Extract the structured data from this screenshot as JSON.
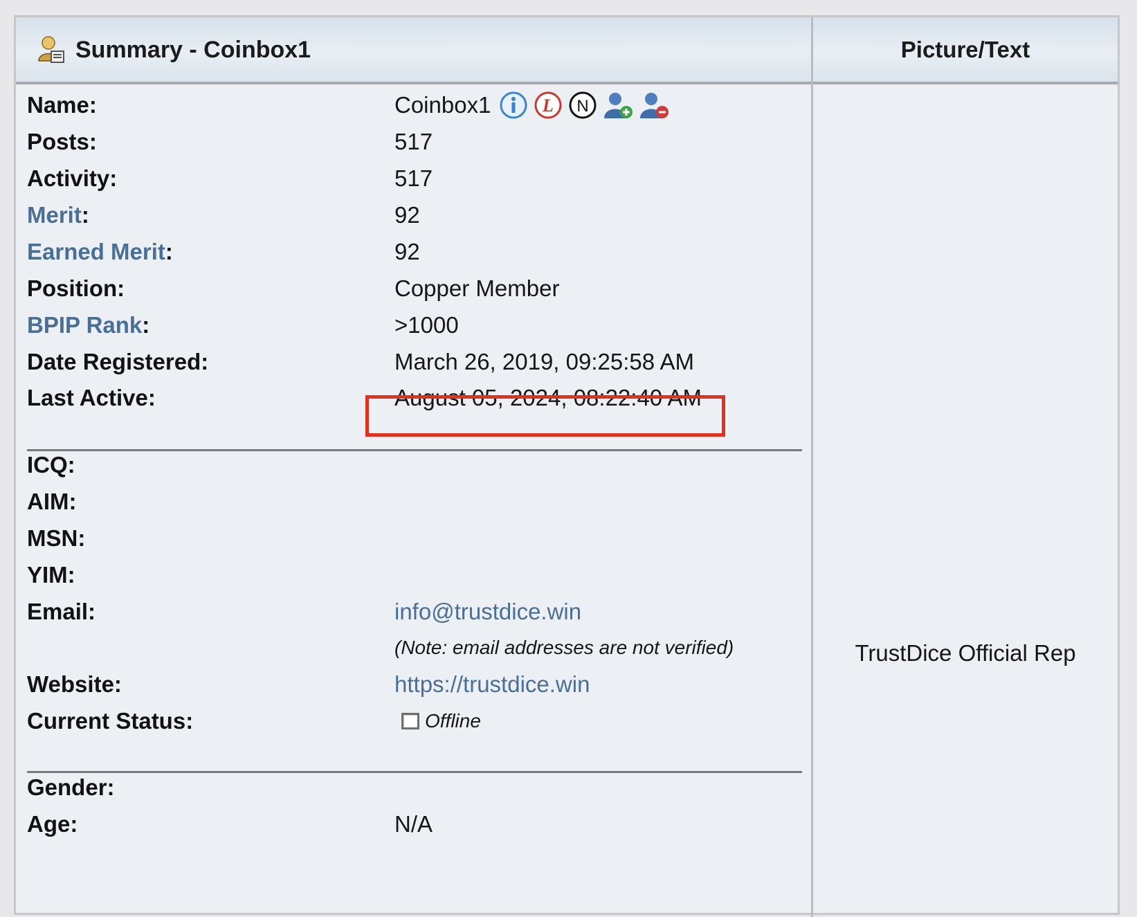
{
  "header": {
    "title": "Summary - Coinbox1",
    "right_title": "Picture/Text"
  },
  "profile": {
    "name_label": "Name:",
    "name": "Coinbox1",
    "posts_label": "Posts:",
    "posts": "517",
    "activity_label": "Activity:",
    "activity": "517",
    "merit_link": "Merit",
    "merit": "92",
    "earned_merit_link": "Earned Merit",
    "earned_merit": "92",
    "position_label": "Position:",
    "position": "Copper Member",
    "bpip_link": "BPIP Rank",
    "bpip": ">1000",
    "date_registered_label": "Date Registered:",
    "date_registered": "March 26, 2019, 09:25:58 AM",
    "last_active_label": "Last Active:",
    "last_active": "August 05, 2024, 08:22:40 AM"
  },
  "contact": {
    "icq_label": "ICQ:",
    "aim_label": "AIM:",
    "msn_label": "MSN:",
    "yim_label": "YIM:",
    "email_label": "Email:",
    "email": "info@trustdice.win",
    "email_note": "(Note: email addresses are not verified)",
    "website_label": "Website:",
    "website": "https://trustdice.win",
    "status_label": "Current Status:",
    "status": "Offline"
  },
  "personal": {
    "gender_label": "Gender:",
    "age_label": "Age:",
    "age": "N/A"
  },
  "picture_text": "TrustDice Official Rep",
  "icons": [
    "user-info-icon",
    "letter-l-icon",
    "letter-n-icon",
    "add-buddy-icon",
    "remove-buddy-icon"
  ],
  "colors": {
    "link": "#4a6f97",
    "highlight": "#e3301c"
  }
}
